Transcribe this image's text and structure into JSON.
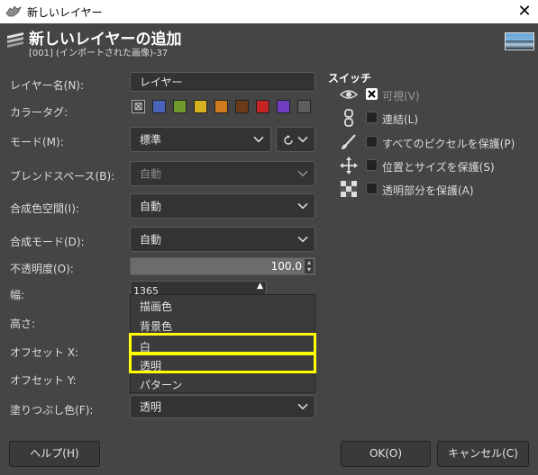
{
  "window": {
    "title": "新しいレイヤー",
    "close_glyph": "✕"
  },
  "header": {
    "title": "新しいレイヤーの追加",
    "subtitle": "[001] (インポートされた画像)-37"
  },
  "form": {
    "layer_name": {
      "label": "レイヤー名(N):",
      "value": "レイヤー"
    },
    "color_tag": {
      "label": "カラータグ:",
      "none_glyph": "⊠",
      "colors": [
        "#4a63b8",
        "#6e9a2e",
        "#d6b21e",
        "#d07a1f",
        "#6b3a16",
        "#c42424",
        "#6f3ec2",
        "#5e5e5e"
      ]
    },
    "mode": {
      "label": "モード(M):",
      "value": "標準"
    },
    "blend_space": {
      "label": "ブレンドスペース(B):",
      "value": "自動"
    },
    "composite_space": {
      "label": "合成色空間(I):",
      "value": "自動"
    },
    "composite_mode": {
      "label": "合成モード(D):",
      "value": "自動"
    },
    "opacity": {
      "label": "不透明度(O):",
      "value": "100.0",
      "fraction": 1.0
    },
    "width": {
      "label": "幅:",
      "value": "1365"
    },
    "height": {
      "label": "高さ:"
    },
    "offset_x": {
      "label": "オフセット X:"
    },
    "offset_y": {
      "label": "オフセット Y:"
    },
    "fill": {
      "label": "塗りつぶし色(F):",
      "value": "透明"
    }
  },
  "fill_dropdown": {
    "options": [
      "描画色",
      "背景色",
      "白",
      "透明",
      "パターン"
    ],
    "highlight_color": "#ffff00"
  },
  "switches": {
    "title": "スイッチ",
    "items": [
      {
        "label": "可視(V)",
        "icon": "eye-icon",
        "checked": true
      },
      {
        "label": "連結(L)",
        "icon": "chain-icon",
        "checked": false
      },
      {
        "label": "すべてのピクセルを保護(P)",
        "icon": "brush-icon",
        "checked": false
      },
      {
        "label": "位置とサイズを保護(S)",
        "icon": "move-icon",
        "checked": false
      },
      {
        "label": "透明部分を保護(A)",
        "icon": "checkerboard-icon",
        "checked": false
      }
    ]
  },
  "buttons": {
    "help": "ヘルプ(H)",
    "ok": "OK(O)",
    "cancel": "キャンセル(C)"
  }
}
